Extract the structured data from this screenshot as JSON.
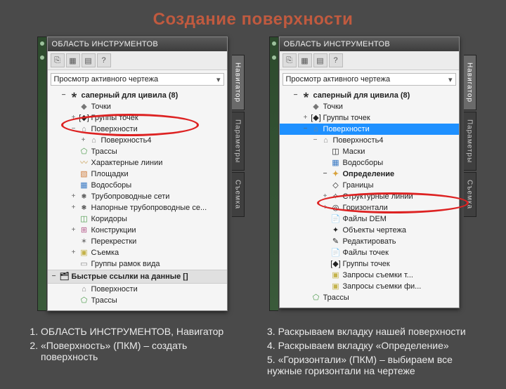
{
  "title": "Создание поверхности",
  "panel_header": "ОБЛАСТЬ ИНСТРУМЕНТОВ",
  "view_selector": "Просмотр активного чертежа",
  "sidetabs": {
    "nav": "Навигатор",
    "params": "Параметры",
    "survey": "Съемка"
  },
  "left_tree": {
    "root": "саперный для цивила (8)",
    "items": [
      "Точки",
      "Группы точек",
      "Поверхности",
      "Поверхность4",
      "Трассы",
      "Характерные линии",
      "Площадки",
      "Водосборы",
      "Трубопроводные сети",
      "Напорные трубопроводные се...",
      "Коридоры",
      "Конструкции",
      "Перекрестки",
      "Съемка",
      "Группы рамок вида"
    ],
    "quick": "Быстрые ссылки на данные []",
    "quick_items": [
      "Поверхности",
      "Трассы"
    ]
  },
  "right_tree": {
    "root": "саперный для цивила (8)",
    "pre": [
      "Точки",
      "Группы точек"
    ],
    "surf": "Поверхности",
    "surf4": "Поверхность4",
    "sub4": [
      "Маски",
      "Водосборы"
    ],
    "def": "Определение",
    "def_items": [
      "Границы",
      "Структурные линии",
      "Горизонтали",
      "Файлы DEM",
      "Объекты чертежа",
      "Редактировать",
      "Файлы точек",
      "Группы точек",
      "Запросы съемки т...",
      "Запросы съемки фи..."
    ],
    "tail": "Трассы"
  },
  "steps": {
    "l1": "ОБЛАСТЬ ИНСТРУМЕНТОВ, Навигатор",
    "l2": "«Поверхность» (ПКМ) – создать поверхность",
    "r3": "3. Раскрываем вкладку нашей поверхности",
    "r4": "4. Раскрываем вкладку «Определение»",
    "r5": "5. «Горизонтали» (ПКМ) – выбираем все нужные горизонтали на чертеже"
  }
}
